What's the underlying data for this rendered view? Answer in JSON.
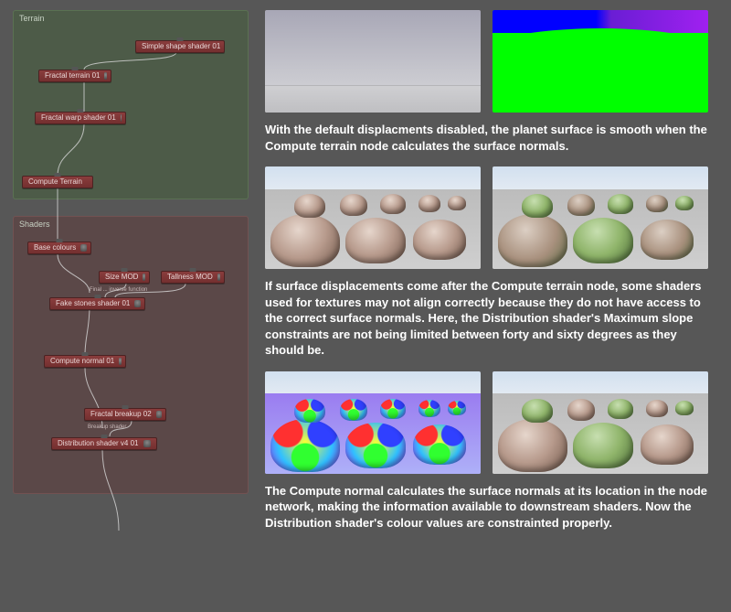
{
  "groups": {
    "terrain": {
      "title": "Terrain"
    },
    "shaders": {
      "title": "Shaders"
    }
  },
  "nodes": {
    "simple_shape": "Simple shape shader 01",
    "fractal_terrain": "Fractal terrain 01",
    "fractal_warp": "Fractal warp shader 01",
    "compute_terrain": "Compute Terrain",
    "base_colours": "Base colours",
    "size_mod": "Size MOD",
    "tallness_mod": "Tallness MOD",
    "fn_label_sm": "Final ... inverse function",
    "fake_stones": "Fake stones shader 01",
    "compute_normal": "Compute normal 01",
    "fractal_breakup": "Fractal breakup 02",
    "breakup_shader": "Breakup shader",
    "distribution": "Distribution shader v4 01"
  },
  "captions": {
    "row1": "With the default displacments disabled, the planet surface is smooth when the Compute terrain node calculates the surface normals.",
    "row2": "If surface displacements come after the Compute terrain node, some shaders used for textures may not align correctly because they do not have access to the correct surface normals.  Here, the Distribution shader's Maximum slope constraints are not being limited between forty and sixty degrees as they should be.",
    "row3": "The Compute normal calculates the surface normals at its location in the node network, making the information available to downstream shaders. Now the Distribution shader's colour values are constrainted properly."
  }
}
